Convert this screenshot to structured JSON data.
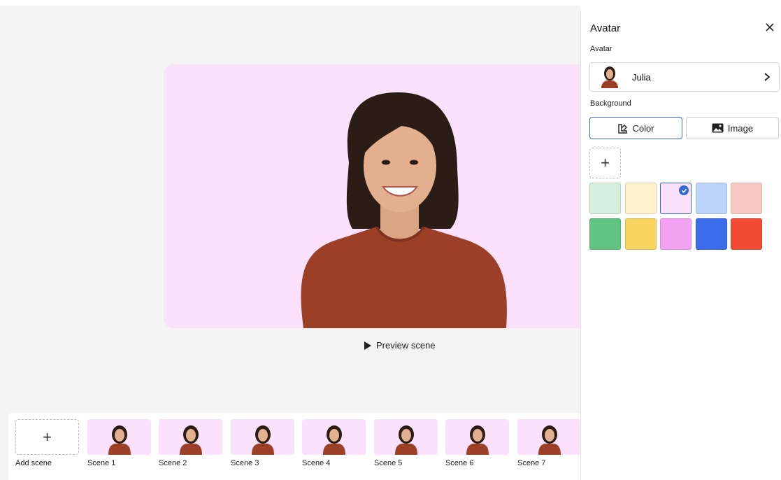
{
  "preview": {
    "label": "Preview scene"
  },
  "filmstrip": {
    "add_label": "Add scene",
    "scenes": [
      "Scene 1",
      "Scene 2",
      "Scene 3",
      "Scene 4",
      "Scene 5",
      "Scene 6",
      "Scene 7"
    ]
  },
  "panel": {
    "title": "Avatar",
    "avatar_label": "Avatar",
    "avatar_name": "Julia",
    "background_label": "Background",
    "tab_color": "Color",
    "tab_image": "Image",
    "selected_tab": "Color"
  },
  "colors": {
    "accent": "#3466d6",
    "canvas_bg": "#fbe1fb",
    "swatches": [
      "#d4efdd",
      "#fdf2cc",
      "#fbe1fb",
      "#bcd4fa",
      "#f8c8c2",
      "#62c383",
      "#f9d45f",
      "#f3a2f3",
      "#3a6ceb",
      "#f24a33"
    ],
    "selected_swatch_index": 2
  }
}
